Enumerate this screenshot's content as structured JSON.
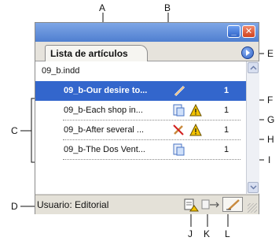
{
  "panel": {
    "tab_label": "Lista de artículos",
    "book_name": "09_b.indd",
    "status_label": "Usuario: Editorial"
  },
  "articles": [
    {
      "name": "09_b-Our desire to...",
      "num": "1",
      "selected": true
    },
    {
      "name": "09_b-Each shop in...",
      "num": "1",
      "selected": false
    },
    {
      "name": "09_b-After several ...",
      "num": "1",
      "selected": false
    },
    {
      "name": "09_b-The Dos Vent...",
      "num": "1",
      "selected": false
    }
  ],
  "callouts": {
    "A": "A",
    "B": "B",
    "C": "C",
    "D": "D",
    "E": "E",
    "F": "F",
    "G": "G",
    "H": "H",
    "I": "I",
    "J": "J",
    "K": "K",
    "L": "L"
  },
  "icons": {
    "row1": [
      "pencil-icon"
    ],
    "row2": [
      "document-icon",
      "warning-icon"
    ],
    "row3": [
      "crossed-pencil-icon",
      "warning-icon"
    ],
    "row4": [
      "document-icon"
    ],
    "status": [
      "document-info-icon",
      "check-in-icon",
      "edit-pencil-icon"
    ]
  },
  "colors": {
    "selection": "#3366cc",
    "titlebar": "#5a87d6",
    "warning": "#f2c200",
    "close": "#d0421f"
  }
}
